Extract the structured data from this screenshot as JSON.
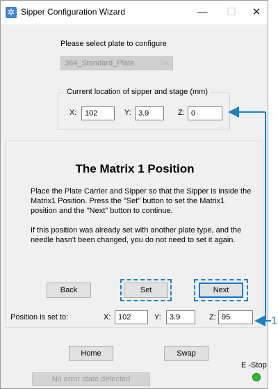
{
  "window": {
    "title": "Sipper Configuration Wizard"
  },
  "titlebar_buttons": {
    "minimize": "—",
    "maximize": "☐",
    "close": "✕"
  },
  "plate": {
    "prompt": "Please select plate to configure",
    "selected": "384_Standard_Plate"
  },
  "current_location": {
    "title": "Current location of sipper and stage (mm)",
    "x_label": "X:",
    "x_value": "102",
    "y_label": "Y:",
    "y_value": "3.9",
    "z_label": "Z:",
    "z_value": "0"
  },
  "matrix": {
    "heading": "The Matrix 1 Position",
    "instructions": "Place the Plate Carrier and Sipper so that the Sipper is inside the Matrix1 Position. Press the \"Set\" button to set the Matrix1 position and the \"Next\" button to continue.",
    "note": "If this position was already set with another plate type, and the needle hasn't been changed, you do not need to set it again."
  },
  "buttons": {
    "back": "Back",
    "set": "Set",
    "next": "Next",
    "home": "Home",
    "swap": "Swap"
  },
  "position_set": {
    "label": "Position is set to:",
    "x_label": "X:",
    "x_value": "102",
    "y_label": "Y:",
    "y_value": "3.9",
    "z_label": "Z:",
    "z_value": "95"
  },
  "estop": {
    "label": "E -Stop",
    "color": "#22c522"
  },
  "status": {
    "text": "No error state detected"
  },
  "callout": {
    "number": "1",
    "color": "#1a82c8"
  }
}
